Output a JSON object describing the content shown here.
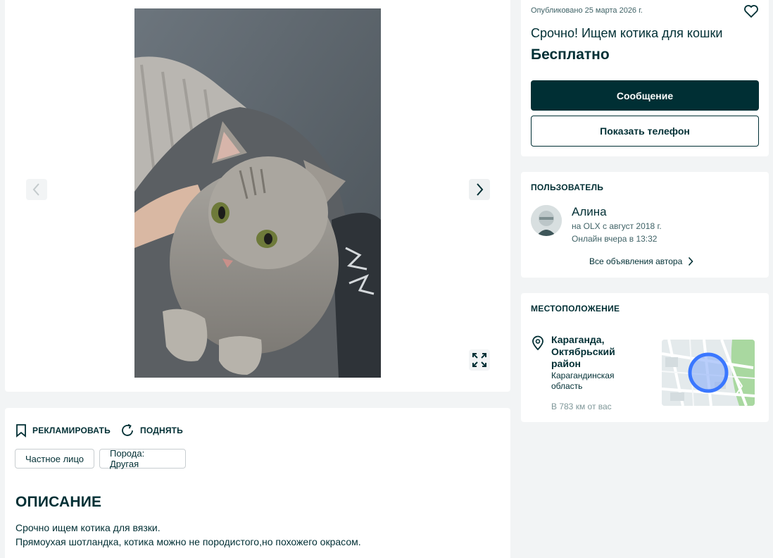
{
  "gallery": {
    "photo_alt": "",
    "prev_icon": "chevron-left-icon",
    "next_icon": "chevron-right-icon",
    "fullscreen_icon": "expand-icon"
  },
  "actions": {
    "promote": "РЕКЛАМИРОВАТЬ",
    "raise": "ПОДНЯТЬ"
  },
  "tags": [
    "Частное лицо",
    "Порода: Другая"
  ],
  "description": {
    "title": "ОПИСАНИЕ",
    "lines": [
      "Срочно ищем котика для вязки.",
      "Прямоухая шотландка, котика можно не породистого,но похожего окрасом."
    ]
  },
  "ad": {
    "published": "Опубликовано 25 марта 2026 г.",
    "title": "Срочно! Ищем котика для кошки",
    "price": "Бесплатно",
    "message_button": "Сообщение",
    "phone_button": "Показать телефон"
  },
  "user": {
    "heading": "ПОЛЬЗОВАТЕЛЬ",
    "name": "Алина",
    "since": "на OLX с август 2018 г.",
    "online": "Онлайн вчера в 13:32",
    "all_ads_link": "Все объявления автора"
  },
  "location": {
    "heading": "МЕСТОПОЛОЖЕНИЕ",
    "city": "Караганда, Октябрьский район",
    "region": "Карагандинская область",
    "distance": "В 783 км от вас"
  },
  "colors": {
    "primary": "#002f34",
    "background": "#f2f4f5",
    "map_marker": "#3a77ff"
  }
}
